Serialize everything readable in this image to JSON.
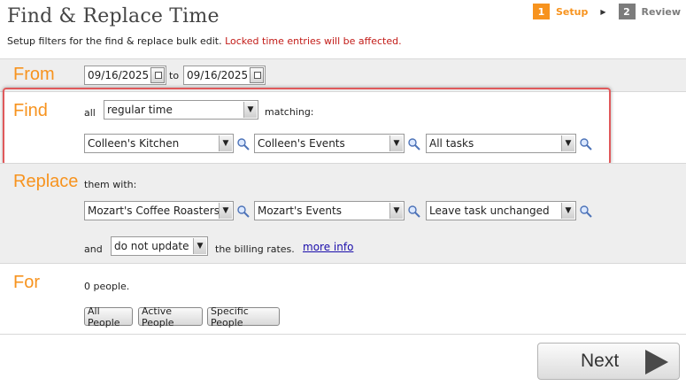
{
  "header": {
    "title": "Find & Replace Time",
    "subtitle": "Setup filters for the find & replace bulk edit.",
    "warning": "Locked time entries will be affected."
  },
  "steps": [
    {
      "number": "1",
      "label": "Setup",
      "state": "active"
    },
    {
      "number": "2",
      "label": "Review",
      "state": "inactive"
    }
  ],
  "from": {
    "label": "From",
    "start_date": "09/16/2025",
    "to_text": "to",
    "end_date": "09/16/2025"
  },
  "find": {
    "label": "Find",
    "all_text": "all",
    "time_type": "regular time",
    "matching_text": "matching:",
    "client": "Colleen's Kitchen",
    "project": "Colleen's Events",
    "task": "All tasks"
  },
  "replace": {
    "label": "Replace",
    "with_text": "them with:",
    "client": "Mozart's Coffee Roasters",
    "project": "Mozart's Events",
    "task": "Leave task unchanged",
    "and_text": "and",
    "billing_option": "do not update",
    "billing_text": "the billing rates.",
    "more_info": "more info"
  },
  "for": {
    "label": "For",
    "people_count_text": "0 people.",
    "buttons": [
      "All People",
      "Active People",
      "Specific People"
    ]
  },
  "footer": {
    "next_label": "Next"
  },
  "colors": {
    "accent": "#f7931e",
    "warning": "#c21b17",
    "highlight": "#e0595b",
    "link": "#1a0dab"
  }
}
